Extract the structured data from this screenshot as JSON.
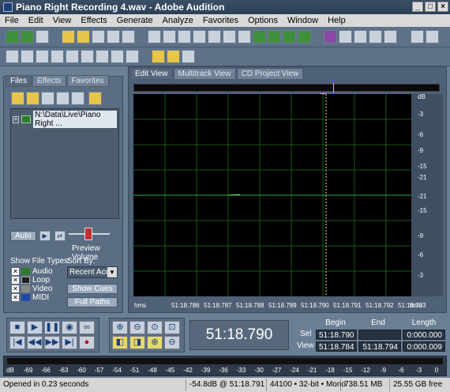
{
  "window": {
    "title": "Piano Right Recording 4.wav - Adobe Audition",
    "min": "_",
    "max": "□",
    "close": "×"
  },
  "menu": [
    "File",
    "Edit",
    "View",
    "Effects",
    "Generate",
    "Analyze",
    "Favorites",
    "Options",
    "Window",
    "Help"
  ],
  "left_tabs": [
    "Files",
    "Effects",
    "Favorites"
  ],
  "file_item": "N:\\Data\\Live\\Piano Right ...",
  "auto_button": "Auto",
  "preview_volume_label": "Preview Volume",
  "show_file_types_label": "Show File Types:",
  "file_types": [
    {
      "label": "Audio",
      "checked": true
    },
    {
      "label": "Loop",
      "checked": true
    },
    {
      "label": "Video",
      "checked": true
    },
    {
      "label": "MIDI",
      "checked": true
    }
  ],
  "sort_by_label": "Sort By:",
  "sort_value": "Recent Acce",
  "show_cues_button": "Show Cues",
  "full_paths_button": "Full Paths",
  "editor_tabs": [
    "Edit View",
    "Multitrack View",
    "CD Project View"
  ],
  "db_labels": [
    "dB",
    "-3",
    "-6",
    "-9",
    "-15",
    "-21",
    "-21",
    "-15",
    "-9",
    "-6",
    "-3"
  ],
  "time_unit": "hms",
  "time_ticks": [
    "51:18.786",
    "51:18.787",
    "51:18.788",
    "51:18.789",
    "51:18.790",
    "51:18.791",
    "51:18.792",
    "51:18.793"
  ],
  "time_display": "51:18.790",
  "sel_view": {
    "headers": [
      "Begin",
      "End",
      "Length"
    ],
    "sel_label": "Sel",
    "view_label": "View",
    "sel": [
      "51:18.790",
      "",
      "0:000.000"
    ],
    "view": [
      "51:18.784",
      "51:18.794",
      "0:000.009"
    ]
  },
  "level_scale": [
    "dB",
    "-69",
    "-66",
    "-63",
    "-60",
    "-57",
    "-54",
    "-51",
    "-48",
    "-45",
    "-42",
    "-39",
    "-36",
    "-33",
    "-30",
    "-27",
    "-24",
    "-21",
    "-18",
    "-15",
    "-12",
    "-9",
    "-6",
    "-3",
    "0"
  ],
  "status": {
    "message": "Opened in 0.23 seconds",
    "cursor": "-54.8dB @  51:18.791",
    "format": "44100 • 32-bit • Mono",
    "size": "738.51 MB",
    "free": "25.55 GB free"
  }
}
